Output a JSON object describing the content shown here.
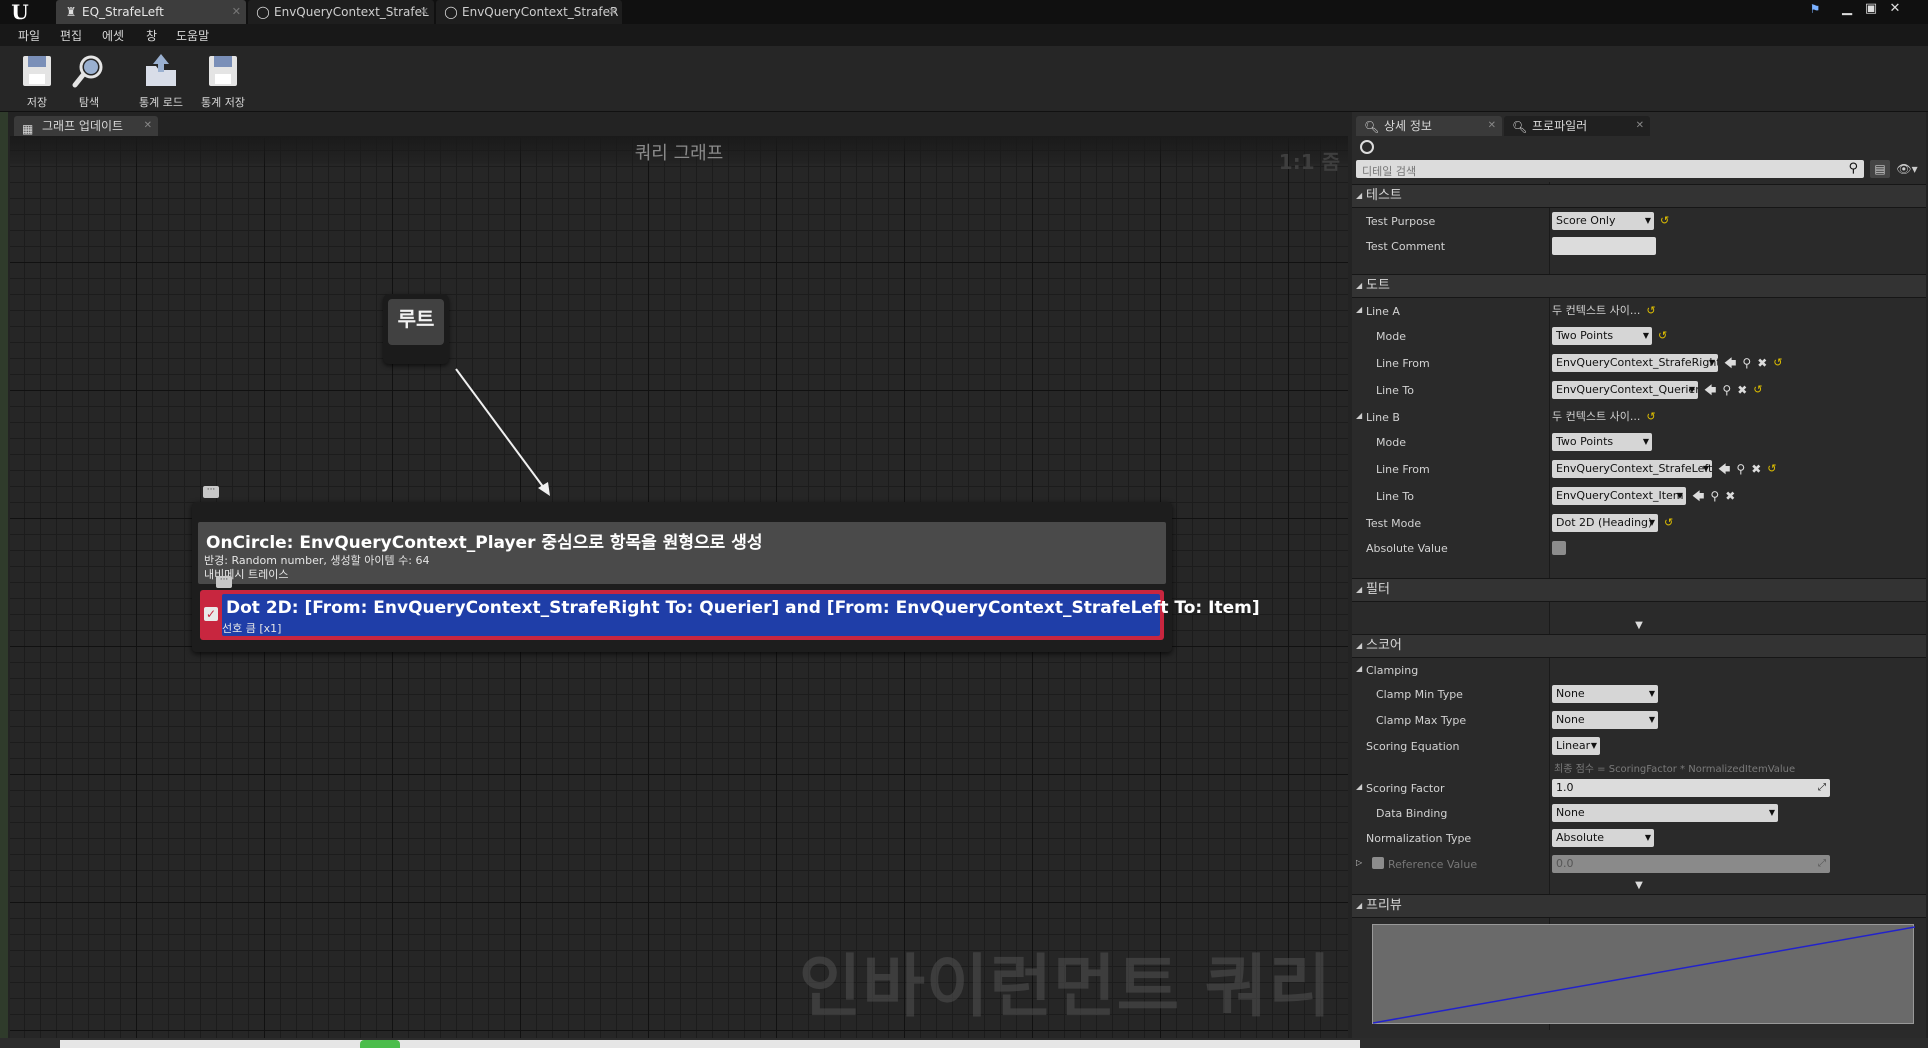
{
  "titlebar": {
    "tabs": [
      {
        "label": "EQ_StrafeLeft",
        "icon": "query-asset-icon",
        "active": true
      },
      {
        "label": "EnvQueryContext_StrafeL",
        "icon": "blueprint-circle-icon",
        "active": false
      },
      {
        "label": "EnvQueryContext_StrafeR",
        "icon": "blueprint-circle-icon",
        "active": false
      }
    ]
  },
  "menubar": {
    "items": [
      "파일",
      "편집",
      "에셋",
      "창",
      "도움말"
    ]
  },
  "toolbar": {
    "save_label": "저장",
    "browse_label": "탐색",
    "load_stats_label": "통계 로드",
    "save_stats_label": "통계 저장"
  },
  "graph_panel": {
    "tab_label": "그래프 업데이트",
    "title": "쿼리 그래프",
    "zoom": "1:1 줌",
    "watermark": "인바이런먼트 쿼리",
    "root_label": "루트",
    "generator": {
      "title": "OnCircle: EnvQueryContext_Player 중심으로 항목을 원형으로 생성",
      "line1": "반경: Random number, 생성할 아이템 수: 64",
      "line2": "내비메시 트레이스"
    },
    "test": {
      "title": "Dot 2D: [From: EnvQueryContext_StrafeRight To: Querier] and [From: EnvQueryContext_StrafeLeft To: Item]",
      "subtitle": "선호 큼 [x1]"
    }
  },
  "details_panel": {
    "tabs": [
      "상세 정보",
      "프로파일러"
    ],
    "search_placeholder": "디테일 검색",
    "sections": {
      "test": "테스트",
      "dot": "도트",
      "filter": "필터",
      "score": "스코어",
      "preview": "프리뷰"
    },
    "props": {
      "test_purpose": {
        "label": "Test Purpose",
        "value": "Score Only"
      },
      "test_comment": {
        "label": "Test Comment",
        "value": ""
      },
      "line_a": {
        "label": "Line A",
        "value": "두 컨텍스트 사이..."
      },
      "line_a_mode": {
        "label": "Mode",
        "value": "Two Points"
      },
      "line_a_from": {
        "label": "Line From",
        "value": "EnvQueryContext_StrafeRight"
      },
      "line_a_to": {
        "label": "Line To",
        "value": "EnvQueryContext_Querier"
      },
      "line_b": {
        "label": "Line B",
        "value": "두 컨텍스트 사이..."
      },
      "line_b_mode": {
        "label": "Mode",
        "value": "Two Points"
      },
      "line_b_from": {
        "label": "Line From",
        "value": "EnvQueryContext_StrafeLeft"
      },
      "line_b_to": {
        "label": "Line To",
        "value": "EnvQueryContext_Item"
      },
      "test_mode": {
        "label": "Test Mode",
        "value": "Dot 2D (Heading)"
      },
      "absolute_value": {
        "label": "Absolute Value"
      },
      "clamping": {
        "label": "Clamping"
      },
      "clamp_min": {
        "label": "Clamp Min Type",
        "value": "None"
      },
      "clamp_max": {
        "label": "Clamp Max Type",
        "value": "None"
      },
      "scoring_equation": {
        "label": "Scoring Equation",
        "value": "Linear",
        "hint": "최종 점수 = ScoringFactor * NormalizedItemValue"
      },
      "scoring_factor": {
        "label": "Scoring Factor",
        "value": "1.0"
      },
      "data_binding": {
        "label": "Data Binding",
        "value": "None"
      },
      "normalization_type": {
        "label": "Normalization Type",
        "value": "Absolute"
      },
      "reference_value": {
        "label": "Reference Value",
        "value": "0.0"
      }
    }
  },
  "colors": {
    "test_border": "#c8263f",
    "test_body": "#1f3ea8",
    "preview_line": "#2222cc",
    "reset_arrow": "#e0c000"
  }
}
